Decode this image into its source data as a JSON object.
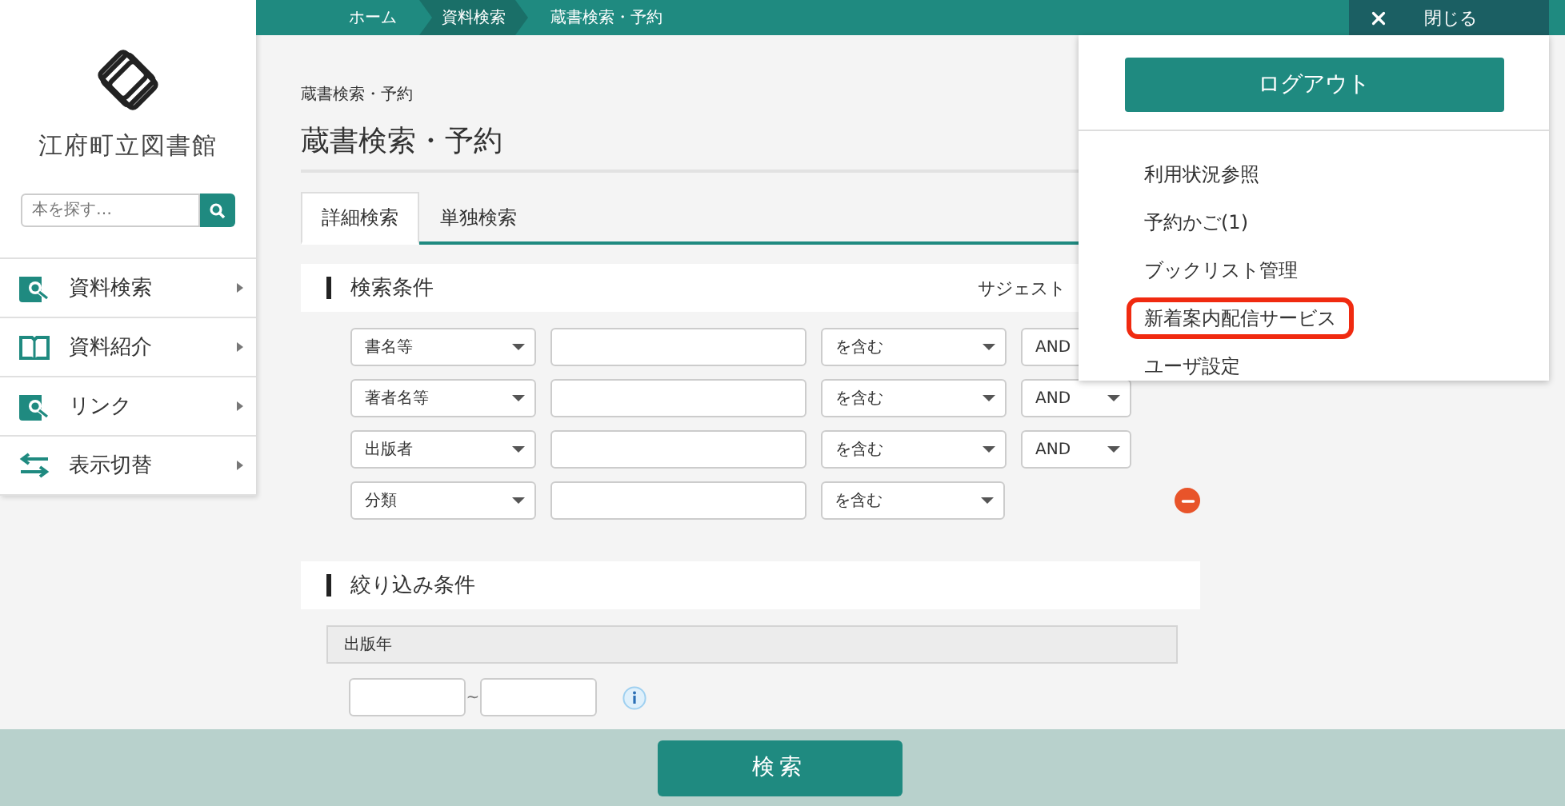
{
  "sidebar": {
    "library_name": "江府町立図書館",
    "search": {
      "placeholder": "本を探す…"
    },
    "nav": [
      {
        "label": "資料検索",
        "kind": "search"
      },
      {
        "label": "資料紹介",
        "kind": "book"
      },
      {
        "label": "リンク",
        "kind": "search"
      },
      {
        "label": "表示切替",
        "kind": "swap"
      }
    ]
  },
  "breadcrumb_bar": {
    "items": [
      {
        "label": "ホーム",
        "highlighted": false
      },
      {
        "label": "資料検索",
        "highlighted": true
      },
      {
        "label": "蔵書検索・予約",
        "highlighted": false
      }
    ],
    "close_button": {
      "label": "閉じる"
    }
  },
  "page": {
    "breadcrumb": "蔵書検索・予約",
    "title": "蔵書検索・予約",
    "tabs": [
      {
        "label": "詳細検索",
        "selected": true
      },
      {
        "label": "単独検索",
        "selected": false
      }
    ],
    "conditions": {
      "title": "検索条件",
      "suggest_label": "サジェスト",
      "rows": [
        {
          "field": "書名等",
          "operator": "を含む",
          "connector": "AND",
          "removable": false
        },
        {
          "field": "著者名等",
          "operator": "を含む",
          "connector": "AND",
          "removable": false
        },
        {
          "field": "出版者",
          "operator": "を含む",
          "connector": "AND",
          "removable": false
        },
        {
          "field": "分類",
          "operator": "を含む",
          "removable": true
        }
      ]
    },
    "filters": {
      "title": "絞り込み条件",
      "groups": [
        {
          "label": "出版年",
          "separator": "~"
        }
      ]
    }
  },
  "user_menu": {
    "logout_button": "ログアウト",
    "items": [
      {
        "label": "利用状況参照",
        "highlighted": false
      },
      {
        "label": "予約かご(1)",
        "highlighted": false
      },
      {
        "label": "ブックリスト管理",
        "highlighted": false
      },
      {
        "label": "新着案内配信サービス",
        "highlighted": true
      },
      {
        "label": "ユーザ設定",
        "highlighted": false
      }
    ]
  },
  "search_button": "検索"
}
